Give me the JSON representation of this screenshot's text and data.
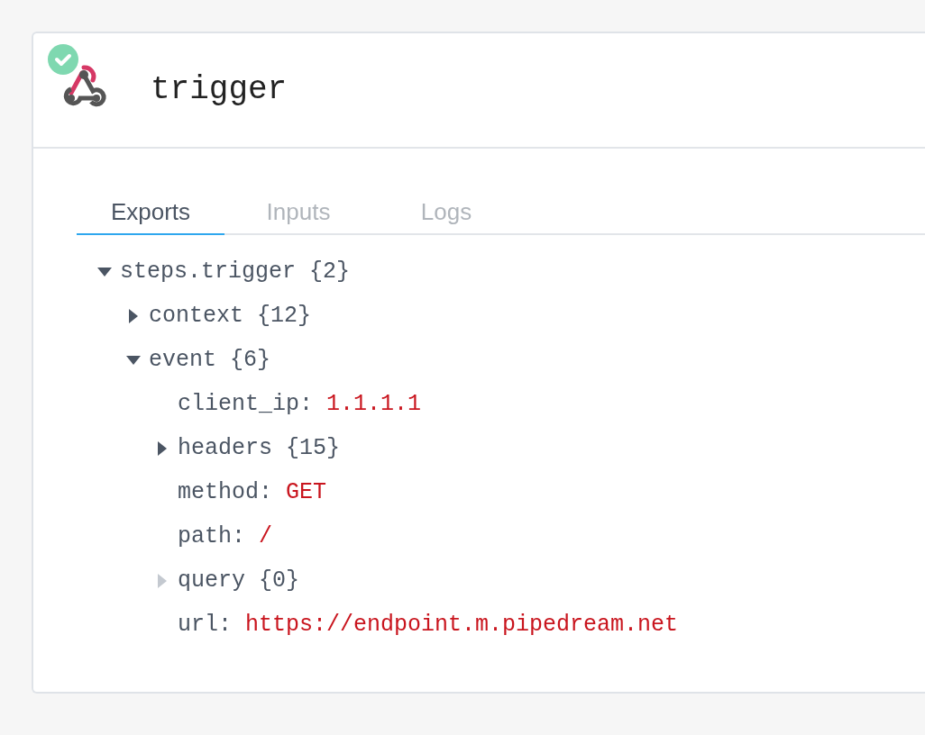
{
  "step": {
    "title": "trigger",
    "success": true
  },
  "tabs": [
    {
      "label": "Exports",
      "selected": true
    },
    {
      "label": "Inputs",
      "selected": false
    },
    {
      "label": "Logs",
      "selected": false
    }
  ],
  "tree": [
    {
      "kind": "object",
      "label": "steps.trigger {2}",
      "expanded": true,
      "disabled": false,
      "children": [
        {
          "kind": "object",
          "label": "context {12}",
          "expanded": false,
          "disabled": false
        },
        {
          "kind": "object",
          "label": "event {6}",
          "expanded": true,
          "disabled": false,
          "children": [
            {
              "kind": "value",
              "key": "client_ip:",
              "value": "1.1.1.1"
            },
            {
              "kind": "object",
              "label": "headers {15}",
              "expanded": false,
              "disabled": false
            },
            {
              "kind": "value",
              "key": "method:",
              "value": "GET"
            },
            {
              "kind": "value",
              "key": "path:",
              "value": "/"
            },
            {
              "kind": "object",
              "label": "query {0}",
              "expanded": false,
              "disabled": true
            },
            {
              "kind": "value",
              "key": "url:",
              "value": "https://endpoint.m.pipedream.net"
            }
          ]
        }
      ]
    }
  ]
}
